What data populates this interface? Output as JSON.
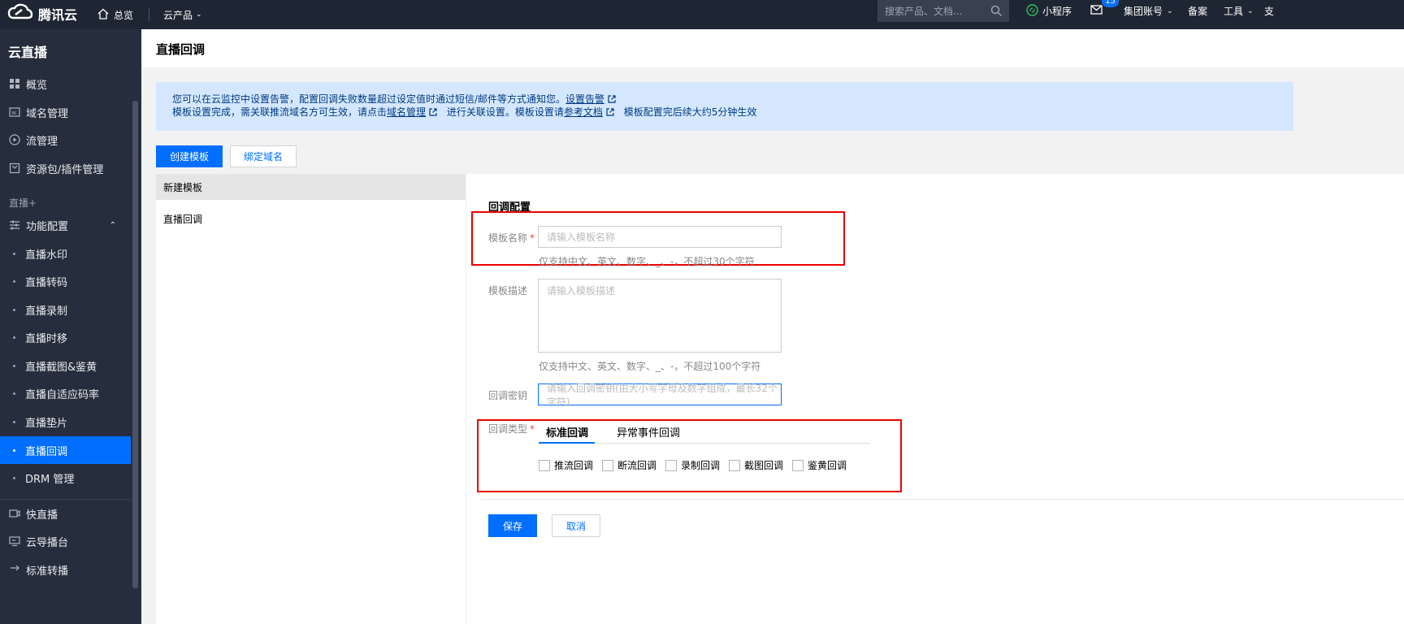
{
  "topbar": {
    "brand": "腾讯云",
    "home": "总览",
    "products": "云产品",
    "search_placeholder": "搜索产品、文档...",
    "miniprogram": "小程序",
    "mail_badge": "15",
    "account": "集团账号",
    "record": "备案",
    "tools": "工具",
    "cut_text": "支"
  },
  "sidebar": {
    "title": "云直播",
    "items": [
      {
        "label": "概览",
        "icon": "grid-icon"
      },
      {
        "label": "域名管理",
        "icon": "domain-icon"
      },
      {
        "label": "流管理",
        "icon": "play-circle-icon"
      },
      {
        "label": "资源包/插件管理",
        "icon": "package-icon"
      }
    ],
    "group": "直播+",
    "feature": "功能配置",
    "subitems": [
      "直播水印",
      "直播转码",
      "直播录制",
      "直播时移",
      "直播截图&鉴黄",
      "直播自适应码率",
      "直播垫片",
      "直播回调",
      "DRM 管理"
    ],
    "active": "直播回调",
    "bottom": [
      {
        "label": "快直播",
        "icon": "fast-live-icon"
      },
      {
        "label": "云导播台",
        "icon": "monitor-icon"
      },
      {
        "label": "标准转播",
        "icon": "relay-icon"
      }
    ]
  },
  "page": {
    "title": "直播回调",
    "notice_line1_prefix": "您可以在云监控中设置告警，配置回调失败数量超过设定值时通过短信/邮件等方式通知您。",
    "notice_line1_link": "设置告警",
    "notice_line2_a": "模板设置完成，需关联推流域名方可生效，请点击",
    "notice_line2_link1": "域名管理",
    "notice_line2_b": "进行关联设置。模板设置请",
    "notice_line2_link2": "参考文档",
    "notice_line2_c": "模板配置完后续大约5分钟生效",
    "create_btn": "创建模板",
    "bind_btn": "绑定域名",
    "templates": [
      "新建模板",
      "直播回调"
    ]
  },
  "form": {
    "section": "回调配置",
    "name_label": "模板名称",
    "name_placeholder": "请输入模板名称",
    "name_hint": "仅支持中文、英文、数字、_、-，不超过30个字符",
    "desc_label": "模板描述",
    "desc_placeholder": "请输入模板描述",
    "desc_hint": "仅支持中文、英文、数字、_、-，不超过100个字符",
    "key_label": "回调密钥",
    "key_placeholder": "请输入回调密钥(由大小写字母及数字组成，最长32个字符)",
    "type_label": "回调类型",
    "tabs": [
      "标准回调",
      "异常事件回调"
    ],
    "checkboxes": [
      "推流回调",
      "断流回调",
      "录制回调",
      "截图回调",
      "鉴黄回调"
    ],
    "save": "保存",
    "cancel": "取消"
  }
}
